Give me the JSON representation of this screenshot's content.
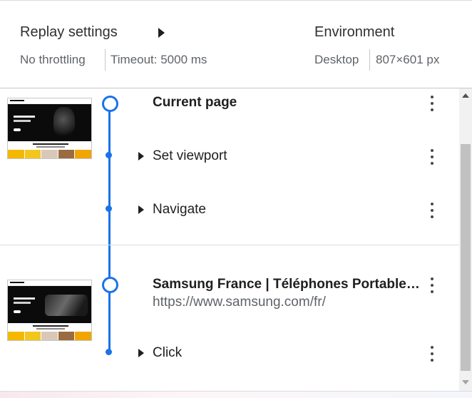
{
  "settings": {
    "replay_title": "Replay settings",
    "throttling": "No throttling",
    "timeout": "Timeout: 5000 ms",
    "environment_title": "Environment",
    "device": "Desktop",
    "viewport": "807×601 px"
  },
  "sections": [
    {
      "title": "Current page",
      "steps": [
        {
          "label": "Set viewport"
        },
        {
          "label": "Navigate"
        }
      ]
    },
    {
      "title": "Samsung France | Téléphones Portables, Tablettes, TV",
      "url": "https://www.samsung.com/fr/",
      "steps": [
        {
          "label": "Click"
        }
      ]
    }
  ],
  "colors": {
    "accent": "#1a73e8",
    "thumb_tiles": [
      "#f5b800",
      "#f2c61f",
      "#d9c8b8",
      "#9a6b3f",
      "#f0a500"
    ]
  },
  "icons": {
    "expand": "triangle-right",
    "menu": "kebab-vertical",
    "node": "circle-outline",
    "step": "dot"
  }
}
